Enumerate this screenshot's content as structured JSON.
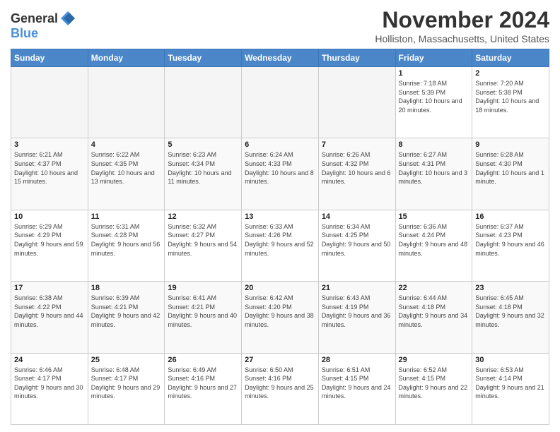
{
  "logo": {
    "text_general": "General",
    "text_blue": "Blue"
  },
  "title": "November 2024",
  "location": "Holliston, Massachusetts, United States",
  "weekdays": [
    "Sunday",
    "Monday",
    "Tuesday",
    "Wednesday",
    "Thursday",
    "Friday",
    "Saturday"
  ],
  "weeks": [
    [
      {
        "day": "",
        "info": ""
      },
      {
        "day": "",
        "info": ""
      },
      {
        "day": "",
        "info": ""
      },
      {
        "day": "",
        "info": ""
      },
      {
        "day": "",
        "info": ""
      },
      {
        "day": "1",
        "info": "Sunrise: 7:18 AM\nSunset: 5:39 PM\nDaylight: 10 hours and 20 minutes."
      },
      {
        "day": "2",
        "info": "Sunrise: 7:20 AM\nSunset: 5:38 PM\nDaylight: 10 hours and 18 minutes."
      }
    ],
    [
      {
        "day": "3",
        "info": "Sunrise: 6:21 AM\nSunset: 4:37 PM\nDaylight: 10 hours and 15 minutes."
      },
      {
        "day": "4",
        "info": "Sunrise: 6:22 AM\nSunset: 4:35 PM\nDaylight: 10 hours and 13 minutes."
      },
      {
        "day": "5",
        "info": "Sunrise: 6:23 AM\nSunset: 4:34 PM\nDaylight: 10 hours and 11 minutes."
      },
      {
        "day": "6",
        "info": "Sunrise: 6:24 AM\nSunset: 4:33 PM\nDaylight: 10 hours and 8 minutes."
      },
      {
        "day": "7",
        "info": "Sunrise: 6:26 AM\nSunset: 4:32 PM\nDaylight: 10 hours and 6 minutes."
      },
      {
        "day": "8",
        "info": "Sunrise: 6:27 AM\nSunset: 4:31 PM\nDaylight: 10 hours and 3 minutes."
      },
      {
        "day": "9",
        "info": "Sunrise: 6:28 AM\nSunset: 4:30 PM\nDaylight: 10 hours and 1 minute."
      }
    ],
    [
      {
        "day": "10",
        "info": "Sunrise: 6:29 AM\nSunset: 4:29 PM\nDaylight: 9 hours and 59 minutes."
      },
      {
        "day": "11",
        "info": "Sunrise: 6:31 AM\nSunset: 4:28 PM\nDaylight: 9 hours and 56 minutes."
      },
      {
        "day": "12",
        "info": "Sunrise: 6:32 AM\nSunset: 4:27 PM\nDaylight: 9 hours and 54 minutes."
      },
      {
        "day": "13",
        "info": "Sunrise: 6:33 AM\nSunset: 4:26 PM\nDaylight: 9 hours and 52 minutes."
      },
      {
        "day": "14",
        "info": "Sunrise: 6:34 AM\nSunset: 4:25 PM\nDaylight: 9 hours and 50 minutes."
      },
      {
        "day": "15",
        "info": "Sunrise: 6:36 AM\nSunset: 4:24 PM\nDaylight: 9 hours and 48 minutes."
      },
      {
        "day": "16",
        "info": "Sunrise: 6:37 AM\nSunset: 4:23 PM\nDaylight: 9 hours and 46 minutes."
      }
    ],
    [
      {
        "day": "17",
        "info": "Sunrise: 6:38 AM\nSunset: 4:22 PM\nDaylight: 9 hours and 44 minutes."
      },
      {
        "day": "18",
        "info": "Sunrise: 6:39 AM\nSunset: 4:21 PM\nDaylight: 9 hours and 42 minutes."
      },
      {
        "day": "19",
        "info": "Sunrise: 6:41 AM\nSunset: 4:21 PM\nDaylight: 9 hours and 40 minutes."
      },
      {
        "day": "20",
        "info": "Sunrise: 6:42 AM\nSunset: 4:20 PM\nDaylight: 9 hours and 38 minutes."
      },
      {
        "day": "21",
        "info": "Sunrise: 6:43 AM\nSunset: 4:19 PM\nDaylight: 9 hours and 36 minutes."
      },
      {
        "day": "22",
        "info": "Sunrise: 6:44 AM\nSunset: 4:18 PM\nDaylight: 9 hours and 34 minutes."
      },
      {
        "day": "23",
        "info": "Sunrise: 6:45 AM\nSunset: 4:18 PM\nDaylight: 9 hours and 32 minutes."
      }
    ],
    [
      {
        "day": "24",
        "info": "Sunrise: 6:46 AM\nSunset: 4:17 PM\nDaylight: 9 hours and 30 minutes."
      },
      {
        "day": "25",
        "info": "Sunrise: 6:48 AM\nSunset: 4:17 PM\nDaylight: 9 hours and 29 minutes."
      },
      {
        "day": "26",
        "info": "Sunrise: 6:49 AM\nSunset: 4:16 PM\nDaylight: 9 hours and 27 minutes."
      },
      {
        "day": "27",
        "info": "Sunrise: 6:50 AM\nSunset: 4:16 PM\nDaylight: 9 hours and 25 minutes."
      },
      {
        "day": "28",
        "info": "Sunrise: 6:51 AM\nSunset: 4:15 PM\nDaylight: 9 hours and 24 minutes."
      },
      {
        "day": "29",
        "info": "Sunrise: 6:52 AM\nSunset: 4:15 PM\nDaylight: 9 hours and 22 minutes."
      },
      {
        "day": "30",
        "info": "Sunrise: 6:53 AM\nSunset: 4:14 PM\nDaylight: 9 hours and 21 minutes."
      }
    ]
  ]
}
